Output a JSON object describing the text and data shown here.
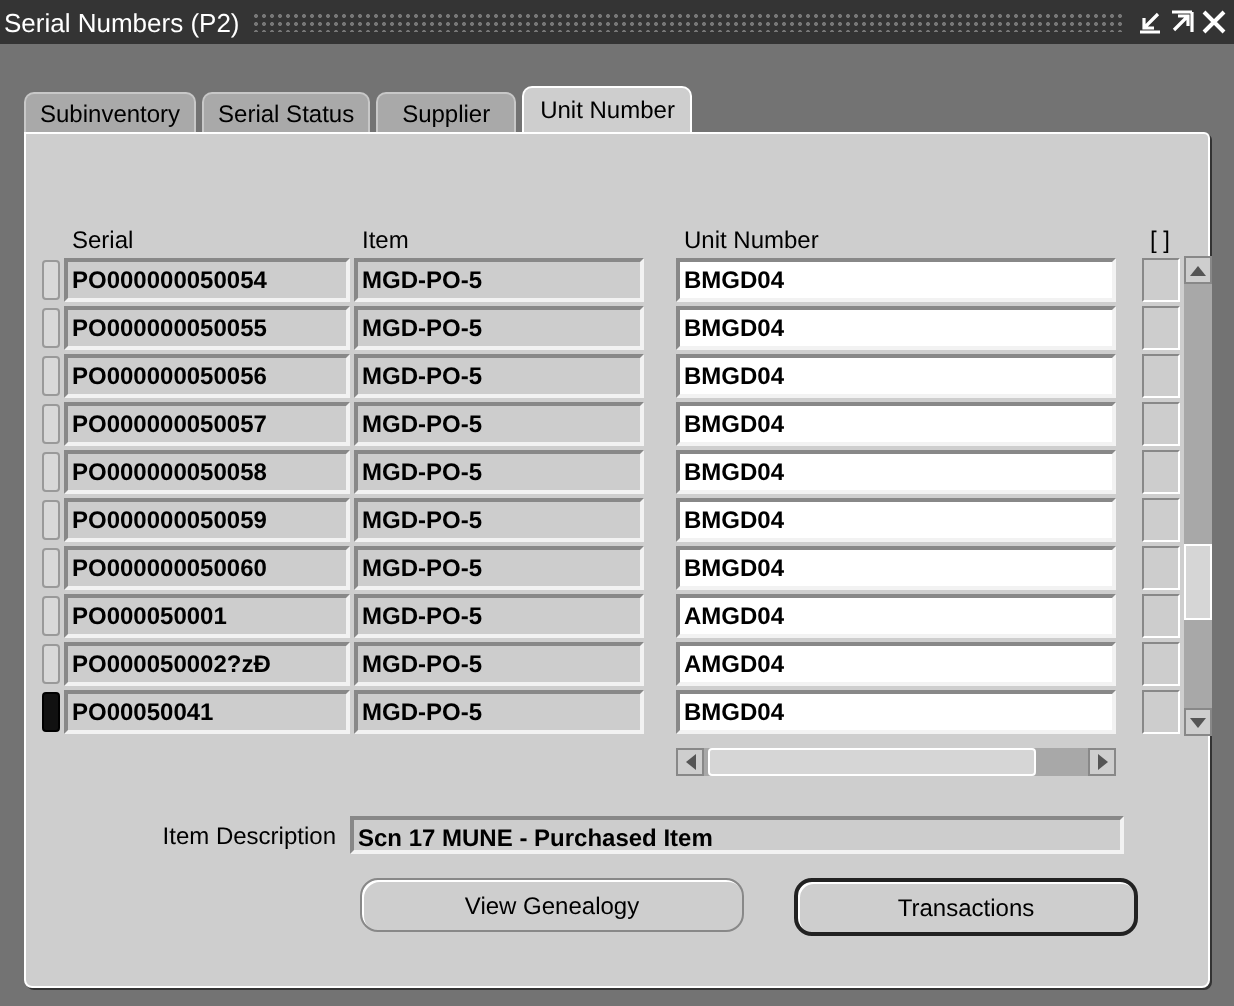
{
  "window": {
    "title": "Serial Numbers (P2)"
  },
  "tabs": [
    {
      "label": "Subinventory",
      "selected": false
    },
    {
      "label": "Serial Status",
      "selected": false
    },
    {
      "label": "Supplier",
      "selected": false
    },
    {
      "label": "Unit Number",
      "selected": true
    }
  ],
  "table": {
    "columns": [
      "Serial",
      "Item",
      "Unit Number",
      "[ ]"
    ],
    "rows": [
      {
        "serial": "PO000000050054",
        "item": "MGD-PO-5",
        "unit_number": "BMGD04",
        "checked": false,
        "selected": false
      },
      {
        "serial": "PO000000050055",
        "item": "MGD-PO-5",
        "unit_number": "BMGD04",
        "checked": false,
        "selected": false
      },
      {
        "serial": "PO000000050056",
        "item": "MGD-PO-5",
        "unit_number": "BMGD04",
        "checked": false,
        "selected": false
      },
      {
        "serial": "PO000000050057",
        "item": "MGD-PO-5",
        "unit_number": "BMGD04",
        "checked": false,
        "selected": false
      },
      {
        "serial": "PO000000050058",
        "item": "MGD-PO-5",
        "unit_number": "BMGD04",
        "checked": false,
        "selected": false
      },
      {
        "serial": "PO000000050059",
        "item": "MGD-PO-5",
        "unit_number": "BMGD04",
        "checked": false,
        "selected": false
      },
      {
        "serial": "PO000000050060",
        "item": "MGD-PO-5",
        "unit_number": "BMGD04",
        "checked": false,
        "selected": false
      },
      {
        "serial": "PO000050001",
        "item": "MGD-PO-5",
        "unit_number": "AMGD04",
        "checked": false,
        "selected": false
      },
      {
        "serial": "PO000050002?zÐ",
        "item": "MGD-PO-5",
        "unit_number": "AMGD04",
        "checked": false,
        "selected": false
      },
      {
        "serial": "PO00050041",
        "item": "MGD-PO-5",
        "unit_number": "BMGD04",
        "checked": false,
        "selected": true
      }
    ]
  },
  "item_description": {
    "label": "Item Description",
    "value": "Scn 17 MUNE - Purchased Item"
  },
  "buttons": [
    {
      "label": "View Genealogy",
      "default": false
    },
    {
      "label": "Transactions",
      "default": true
    }
  ]
}
